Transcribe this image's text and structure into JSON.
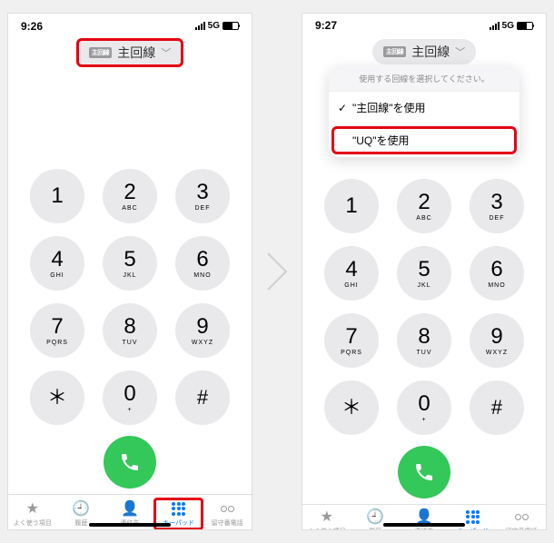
{
  "left": {
    "time": "9:26",
    "network": "5G",
    "line_badge": "主回線",
    "line_label": "主回線"
  },
  "right": {
    "time": "9:27",
    "network": "5G",
    "line_badge": "主回線",
    "line_label": "主回線",
    "popup_title": "使用する回線を選択してください。",
    "popup_opt1": "\"主回線\"を使用",
    "popup_opt2": "\"UQ\"を使用"
  },
  "keys": [
    {
      "n": "1",
      "s": ""
    },
    {
      "n": "2",
      "s": "ABC"
    },
    {
      "n": "3",
      "s": "DEF"
    },
    {
      "n": "4",
      "s": "GHI"
    },
    {
      "n": "5",
      "s": "JKL"
    },
    {
      "n": "6",
      "s": "MNO"
    },
    {
      "n": "7",
      "s": "PQRS"
    },
    {
      "n": "8",
      "s": "TUV"
    },
    {
      "n": "9",
      "s": "WXYZ"
    },
    {
      "n": "＊",
      "s": ""
    },
    {
      "n": "0",
      "s": "+"
    },
    {
      "n": "#",
      "s": ""
    }
  ],
  "tabs": {
    "fav": "よく使う項目",
    "recents": "履歴",
    "contacts": "連絡先",
    "keypad": "キーパッド",
    "voicemail": "留守番電話"
  }
}
